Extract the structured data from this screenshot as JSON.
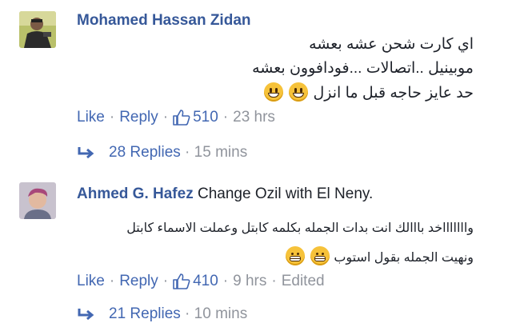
{
  "comments": [
    {
      "author": "Mohamed Hassan Zidan",
      "inline_text": "",
      "lines": [
        "اي كارت شحن عشه بعشه",
        "موبينيل ..اتصالات ...فودافوون بعشه",
        "حد عايز حاجه قبل ما انزل"
      ],
      "emoji": "smile-icon",
      "actions": {
        "like": "Like",
        "reply": "Reply",
        "likes": "510",
        "time": "23 hrs",
        "edited": ""
      },
      "replies": {
        "count_label": "28 Replies",
        "time": "15 mins"
      }
    },
    {
      "author": "Ahmed G. Hafez",
      "inline_text": "Change Ozil with El Neny.",
      "lines": [
        "واااااااخد بااالك انت بدات الجمله بكلمه كابتل وعملت الاسماء كابتل",
        "ونهيت الجمله بقول استوب"
      ],
      "emoji": "grin-icon",
      "actions": {
        "like": "Like",
        "reply": "Reply",
        "likes": "410",
        "time": "9 hrs",
        "edited": "Edited"
      },
      "replies": {
        "count_label": "21 Replies",
        "time": "10 mins"
      }
    }
  ],
  "colors": {
    "name": "#365899",
    "link": "#4267b2",
    "meta": "#90949c",
    "text": "#1d2129"
  }
}
